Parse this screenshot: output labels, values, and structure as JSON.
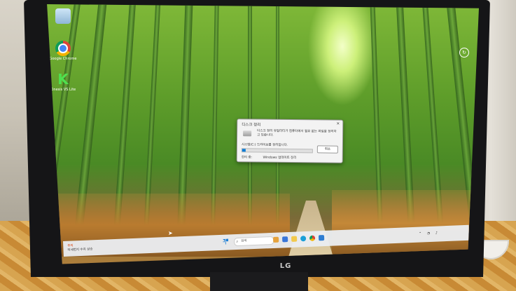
{
  "desktop": {
    "icons": [
      {
        "label": "",
        "icon": "recycle-bin-icon"
      },
      {
        "label": "Google Chrome",
        "icon": "chrome-icon"
      },
      {
        "label": "Kinesis VS Lite",
        "icon": "k-app-icon"
      }
    ]
  },
  "dialog": {
    "title": "디스크 정리",
    "close": "×",
    "message": "디스크 정리 유틸리티가 컴퓨터에서 필요 없는 파일을 정리하고 있습니다.",
    "drive_status": "시스템(C:) 드라이브를 정리합니다.",
    "progress": 0.05,
    "cancel_label": "취소",
    "cleanup_label": "정리 중:",
    "cleanup_value": "Windows 업데이트 정리"
  },
  "taskbar": {
    "weather_title": "주의",
    "weather_text": "미세먼지 수치 상승",
    "search_placeholder": "검색",
    "tray_time": "",
    "tray_date": ""
  },
  "monitor": {
    "brand": "LG"
  },
  "colors": {
    "accent": "#0a7cd6",
    "bamboo": "#5e9d2a"
  }
}
